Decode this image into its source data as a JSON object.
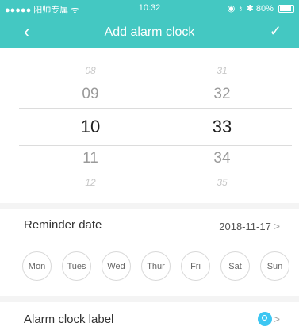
{
  "status_bar": {
    "carrier": "●●●●● 阳帅专属 ᯤ",
    "time": "10:32",
    "icons_right": "◉ ♁ ✱ 80%"
  },
  "navbar": {
    "back_icon": "‹",
    "title": "Add alarm clock",
    "confirm_icon": "✓"
  },
  "picker": {
    "hours": [
      "08",
      "09",
      "10",
      "11",
      "12"
    ],
    "minutes": [
      "31",
      "32",
      "33",
      "34",
      "35"
    ],
    "selected_hour": "10",
    "selected_minute": "33"
  },
  "reminder_date": {
    "label": "Reminder date",
    "value": "2018-11-17",
    "chevron": ">"
  },
  "weekdays": [
    "Mon",
    "Tues",
    "Wed",
    "Thur",
    "Fri",
    "Sat",
    "Sun"
  ],
  "alarm_label": {
    "label": "Alarm clock label",
    "chevron": ">",
    "icon": "alarm-clock-icon",
    "icon_color": "#3dc6f2"
  },
  "colors": {
    "header": "#44c8c2",
    "background_gap": "#f4f4f4"
  }
}
